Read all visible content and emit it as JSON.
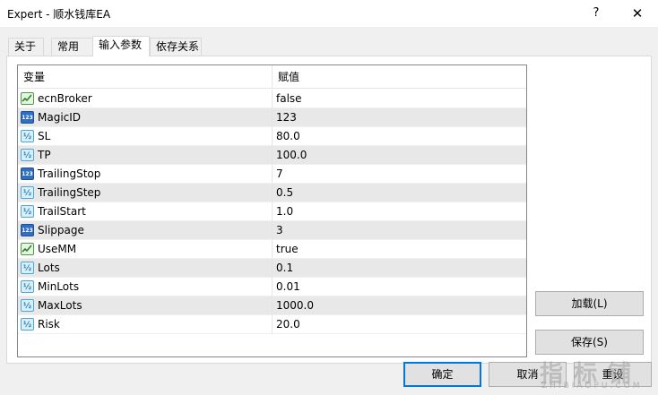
{
  "window": {
    "title": "Expert - 顺水钱库EA",
    "help_glyph": "?",
    "close_glyph": "✕"
  },
  "tabs": [
    {
      "label": "关于"
    },
    {
      "label": "常用"
    },
    {
      "label": "输入参数"
    },
    {
      "label": "依存关系"
    }
  ],
  "grid": {
    "header_name": "变量",
    "header_value": "赋值",
    "rows": [
      {
        "name": "ecnBroker",
        "value": "false",
        "type": "bool-icon"
      },
      {
        "name": "MagicID",
        "value": "123",
        "type": "int-icon"
      },
      {
        "name": "SL",
        "value": "80.0",
        "type": "double-icon"
      },
      {
        "name": "TP",
        "value": "100.0",
        "type": "double-icon"
      },
      {
        "name": "TrailingStop",
        "value": "7",
        "type": "int-icon"
      },
      {
        "name": "TrailingStep",
        "value": "0.5",
        "type": "double-icon"
      },
      {
        "name": "TrailStart",
        "value": "1.0",
        "type": "double-icon"
      },
      {
        "name": "Slippage",
        "value": "3",
        "type": "int-icon"
      },
      {
        "name": "UseMM",
        "value": "true",
        "type": "bool-icon"
      },
      {
        "name": "Lots",
        "value": "0.1",
        "type": "double-icon"
      },
      {
        "name": "MinLots",
        "value": "0.01",
        "type": "double-icon"
      },
      {
        "name": "MaxLots",
        "value": "1000.0",
        "type": "double-icon"
      },
      {
        "name": "Risk",
        "value": "20.0",
        "type": "double-icon"
      }
    ],
    "icon_text_int": "123",
    "icon_text_double": "½"
  },
  "buttons": {
    "load": "加载(L)",
    "save": "保存(S)",
    "ok": "确定",
    "cancel": "取消",
    "reset": "重设"
  },
  "watermark": {
    "big": "指标铺",
    "small": "ZHIBIAOPU.COM"
  },
  "colors": {
    "accent": "#0078d7",
    "alt_row": "#e8e8e8"
  }
}
